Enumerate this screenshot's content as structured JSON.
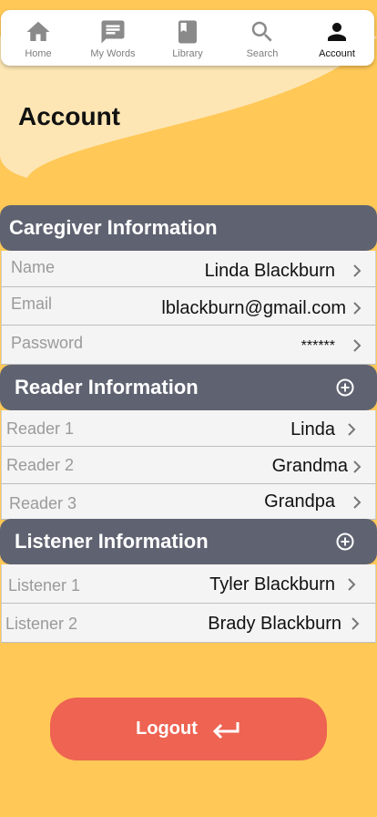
{
  "nav": {
    "items": [
      {
        "label": "Home",
        "icon": "home-icon"
      },
      {
        "label": "My Words",
        "icon": "message-icon"
      },
      {
        "label": "Library",
        "icon": "book-icon"
      },
      {
        "label": "Search",
        "icon": "search-icon"
      },
      {
        "label": "Account",
        "icon": "person-icon",
        "active": true
      }
    ]
  },
  "page": {
    "title": "Account"
  },
  "caregiver": {
    "title": "Caregiver Information",
    "rows": [
      {
        "label": "Name",
        "value": "Linda Blackburn"
      },
      {
        "label": "Email",
        "value": "lblackburn@gmail.com"
      },
      {
        "label": "Password",
        "value": "******"
      }
    ]
  },
  "readers": {
    "title": "Reader Information",
    "rows": [
      {
        "label": "Reader 1",
        "value": "Linda"
      },
      {
        "label": "Reader 2",
        "value": "Grandma"
      },
      {
        "label": "Reader 3",
        "value": "Grandpa"
      }
    ]
  },
  "listeners": {
    "title": "Listener Information",
    "rows": [
      {
        "label": "Listener 1",
        "value": "Tyler Blackburn"
      },
      {
        "label": "Listener 2",
        "value": "Brady Blackburn"
      }
    ]
  },
  "logout": {
    "label": "Logout"
  },
  "colors": {
    "background": "#FFC857",
    "header": "#5F6371",
    "logout": "#EE6352",
    "blob": "#FDE6B4"
  }
}
